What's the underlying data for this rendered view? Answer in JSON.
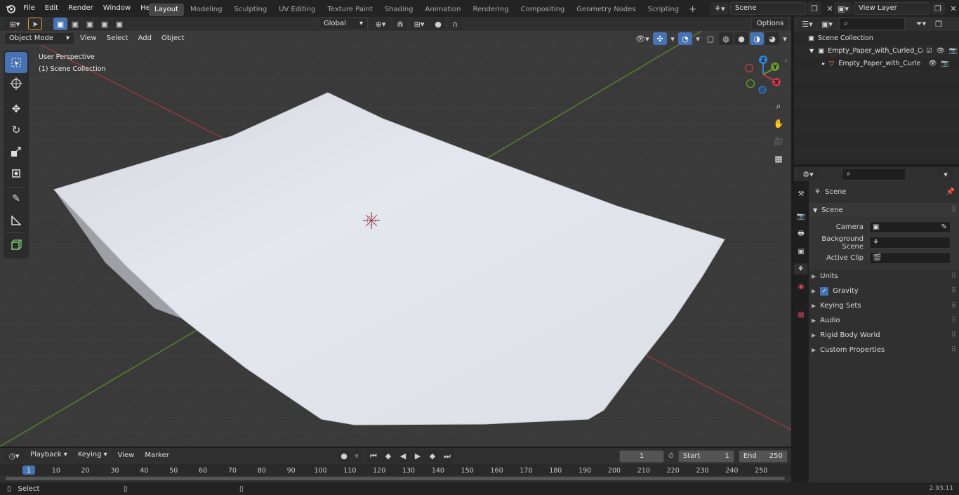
{
  "topbar": {
    "menus": [
      "File",
      "Edit",
      "Render",
      "Window",
      "Help"
    ],
    "workspaces": [
      {
        "label": "Layout",
        "active": true
      },
      {
        "label": "Modeling"
      },
      {
        "label": "Sculpting"
      },
      {
        "label": "UV Editing"
      },
      {
        "label": "Texture Paint"
      },
      {
        "label": "Shading"
      },
      {
        "label": "Animation"
      },
      {
        "label": "Rendering"
      },
      {
        "label": "Compositing"
      },
      {
        "label": "Geometry Nodes"
      },
      {
        "label": "Scripting"
      }
    ],
    "add_tab": "+",
    "scene_name": "Scene",
    "view_layer": "View Layer"
  },
  "viewport_header": {
    "mode": "Object Mode",
    "menus": [
      "View",
      "Select",
      "Add",
      "Object"
    ],
    "orientation": "Global",
    "options": "Options"
  },
  "viewport": {
    "view_name": "User Perspective",
    "collection": "(1) Scene Collection",
    "gizmo": {
      "x": "X",
      "y": "Y",
      "z": "Z"
    }
  },
  "outliner": {
    "rows": [
      {
        "label": "Scene Collection"
      },
      {
        "label": "Empty_Paper_with_Curled_Co"
      },
      {
        "label": "Empty_Paper_with_Curle"
      }
    ]
  },
  "properties": {
    "title": "Scene",
    "panel": "Scene",
    "fields": [
      {
        "label": "Camera"
      },
      {
        "label": "Background Scene"
      },
      {
        "label": "Active Clip"
      }
    ],
    "sections": [
      "Units",
      "Gravity",
      "Keying Sets",
      "Audio",
      "Rigid Body World",
      "Custom Properties"
    ],
    "gravity_checked": true
  },
  "timeline": {
    "menus": [
      "Playback",
      "Keying",
      "View",
      "Marker"
    ],
    "current_frame": "1",
    "start_label": "Start",
    "start": "1",
    "end_label": "End",
    "end": "250",
    "ticks": [
      "1",
      "10",
      "20",
      "30",
      "40",
      "50",
      "60",
      "70",
      "80",
      "90",
      "100",
      "110",
      "120",
      "130",
      "140",
      "150",
      "160",
      "170",
      "180",
      "190",
      "200",
      "210",
      "220",
      "230",
      "240",
      "250"
    ]
  },
  "statusbar": {
    "left": "Select",
    "version": "2.93.11"
  },
  "colors": {
    "accent": "#4772b3",
    "x_axis": "#c23b46",
    "y_axis": "#6a9a2a",
    "z_axis": "#2f86d6",
    "paper": "#e3e6ec",
    "frame_marker": "#4772b3"
  }
}
